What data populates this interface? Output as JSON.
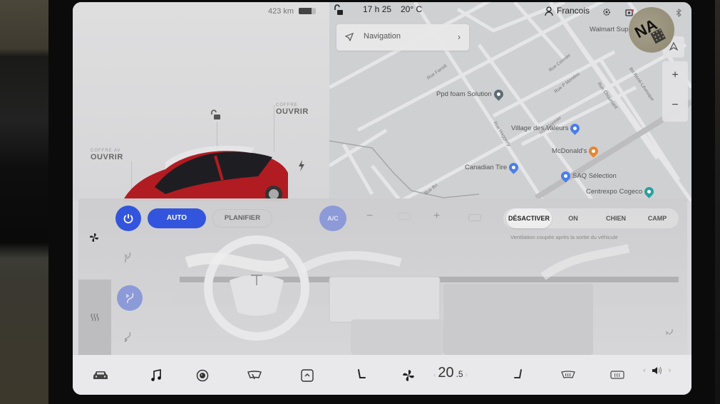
{
  "status_bar": {
    "range": "423 km",
    "battery_percent": 75,
    "time": "17 h 25",
    "outside_temp": "20° C",
    "profile_name": "Francois"
  },
  "sticker": {
    "text": "NA"
  },
  "navigation": {
    "label": "Navigation"
  },
  "map": {
    "zoom_in": "+",
    "zoom_out": "−",
    "pois": [
      {
        "name": "Walmart Supe",
        "color": "#888888"
      },
      {
        "name": "Ppd foam Solution",
        "color": "#5f6b74"
      },
      {
        "name": "Village des Valeurs",
        "color": "#4a7ee8"
      },
      {
        "name": "McDonald's",
        "color": "#e8862f"
      },
      {
        "name": "Canadian Tire",
        "color": "#4a7ee8"
      },
      {
        "name": "SAQ Sélection",
        "color": "#4a7ee8"
      },
      {
        "name": "Centrexpo Cogeco",
        "color": "#2aa0a0"
      }
    ],
    "streets": [
      "Rue Farrell",
      "Rue Cormier",
      "Rue P Mondou",
      "Bd René-Lévesque",
      "Rue Chouinard",
      "Rue Cormier",
      "Rue Haggerty",
      "Rue Bri"
    ]
  },
  "car": {
    "frunk": {
      "small": "COFFRE AV",
      "action": "OUVRIR"
    },
    "trunk": {
      "small": "COFFRE",
      "action": "OUVRIR"
    }
  },
  "climate": {
    "auto_label": "AUTO",
    "schedule_label": "PLANIFIER",
    "ac_label": "A/C",
    "fan_minus": "−",
    "fan_plus": "+",
    "keep_modes": [
      "DÉSACTIVER",
      "ON",
      "CHIEN",
      "CAMP"
    ],
    "keep_selected": "DÉSACTIVER",
    "keep_note": "Ventilation coupée après la sortie du véhicule",
    "accent_color": "#3355dd"
  },
  "dock": {
    "items": [
      "car-icon",
      "music-icon",
      "camera-icon",
      "wiper-icon",
      "app-launcher-icon",
      "driver-seat-icon",
      "fan-icon",
      "passenger-seat-icon",
      "front-defrost-icon",
      "rear-defrost-icon"
    ],
    "temp_whole": "20",
    "temp_decimal": ".5",
    "temp_left_arrow": "‹",
    "temp_right_arrow": "›",
    "vol_left": "‹",
    "vol_right": "›"
  }
}
